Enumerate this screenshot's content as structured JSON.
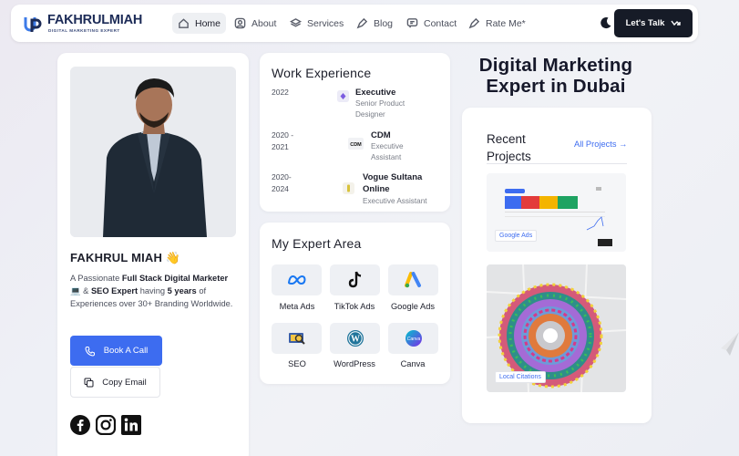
{
  "brand": {
    "name_first": "FAKHRUL",
    "name_second": "MIAH",
    "tagline": "DIGITAL MARKETING EXPERT"
  },
  "nav": {
    "items": [
      {
        "label": "Home",
        "icon": "home-icon"
      },
      {
        "label": "About",
        "icon": "user-icon"
      },
      {
        "label": "Services",
        "icon": "layers-icon"
      },
      {
        "label": "Blog",
        "icon": "pen-icon"
      },
      {
        "label": "Contact",
        "icon": "message-icon"
      },
      {
        "label": "Rate Me*",
        "icon": "pen-icon"
      }
    ],
    "cta_label": "Let's Talk"
  },
  "profile": {
    "name": "FAKHRUL MIAH 👋",
    "desc_1": "A Passionate ",
    "desc_bold_1": "Full Stack Digital Marketer",
    "desc_2": " 💻 & ",
    "desc_bold_2": "SEO Expert",
    "desc_3": " having ",
    "desc_bold_3": "5 years",
    "desc_4": " of Experiences over 30+ Branding Worldwide.",
    "book_call": "Book A Call",
    "copy_email": "Copy Email"
  },
  "work": {
    "title": "Work Experience",
    "jobs": [
      {
        "years": "2022",
        "role": "Executive",
        "sub": "Senior Product Designer"
      },
      {
        "years": "2020 - 2021",
        "role": "CDM",
        "sub": "Executive Assistant"
      },
      {
        "years": "2020- 2024",
        "role": "Vogue Sultana Online",
        "sub": "Executive Assistant"
      }
    ]
  },
  "expert": {
    "title": "My Expert Area",
    "items": [
      "Meta Ads",
      "TikTok Ads",
      "Google Ads",
      "SEO",
      "WordPress",
      "Canva"
    ]
  },
  "headline": "Digital Marketing Expert in Dubai",
  "projects": {
    "title": "Recent Projects",
    "all_link": "All Projects →",
    "items": [
      "Google Ads",
      "Local Citations"
    ]
  },
  "colors": {
    "accent": "#3d6cf0",
    "dark": "#161b27",
    "logo_blue": "#1c2b57"
  }
}
